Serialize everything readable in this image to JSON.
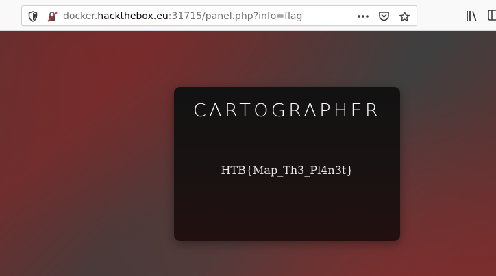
{
  "browser": {
    "url_host_prefix": "docker.",
    "url_host": "hackthebox.eu",
    "url_rest": ":31715/panel.php?info=flag",
    "icons": {
      "security": "shield-icon",
      "connection": "insecure-lock-icon",
      "page_actions": "more-actions-icon",
      "pocket": "pocket-icon",
      "bookmark": "star-icon",
      "library": "library-icon"
    }
  },
  "card": {
    "title": "CARTOGRAPHER",
    "flag": "HTB{Map_Th3_Pl4n3t}"
  }
}
